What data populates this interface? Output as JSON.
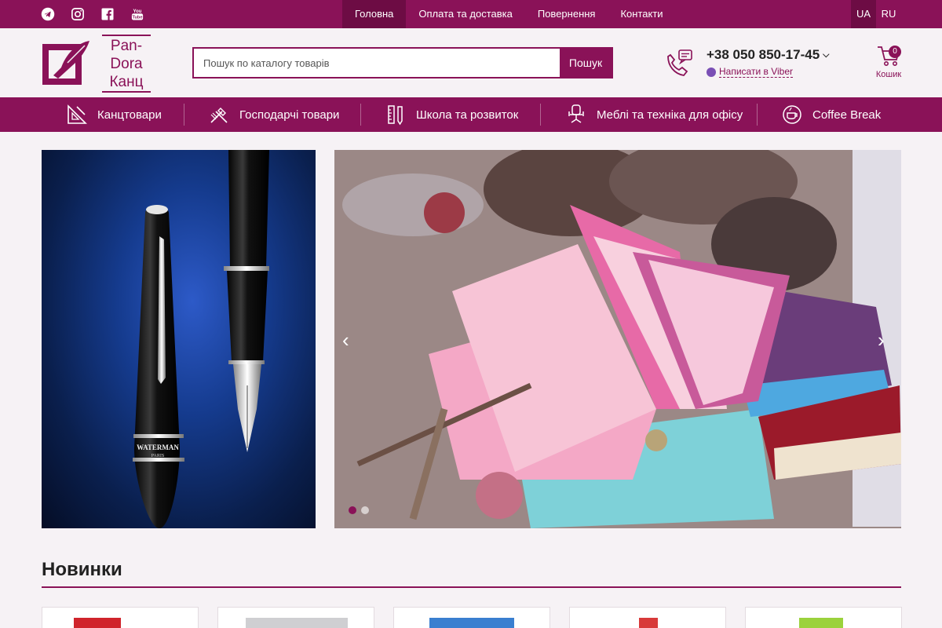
{
  "topbar": {
    "social": [
      {
        "icon": "telegram-icon"
      },
      {
        "icon": "instagram-icon"
      },
      {
        "icon": "facebook-icon"
      },
      {
        "icon": "youtube-icon",
        "text": "You Tube"
      }
    ],
    "nav": [
      {
        "label": "Головна",
        "active": true
      },
      {
        "label": "Оплата та доставка",
        "active": false
      },
      {
        "label": "Повернення",
        "active": false
      },
      {
        "label": "Контакти",
        "active": false
      }
    ],
    "languages": [
      {
        "label": "UA",
        "active": true
      },
      {
        "label": "RU",
        "active": false
      }
    ]
  },
  "header": {
    "logo": {
      "line1": "Pan-",
      "line2": "Dora",
      "line3": "Канц"
    },
    "search": {
      "placeholder": "Пошук по каталогу товарів",
      "value": "",
      "button": "Пошук"
    },
    "phone": "+38 050 850-17-45",
    "viber": "Написати в Viber",
    "cart": {
      "label": "Кошик",
      "count": "0"
    }
  },
  "categories": [
    {
      "label": "Канцтовари",
      "icon": "ruler-triangle-icon"
    },
    {
      "label": "Господарчі товари",
      "icon": "cleaning-tools-icon"
    },
    {
      "label": "Школа та розвиток",
      "icon": "ruler-pencil-icon"
    },
    {
      "label": "Меблі та техніка для офісу",
      "icon": "office-chair-icon"
    },
    {
      "label": "Coffee Break",
      "icon": "coffee-cup-icon"
    }
  ],
  "banners": {
    "left": {
      "pen_text_1": "WATERMAN",
      "pen_text_2": "PARIS"
    },
    "slider": {
      "slides": 2,
      "active": 1
    }
  },
  "new_section": {
    "title": "Новинки"
  },
  "colors": {
    "brand": "#8a1258",
    "brand_dark": "#6d0c44",
    "background": "#f6f2f5"
  }
}
